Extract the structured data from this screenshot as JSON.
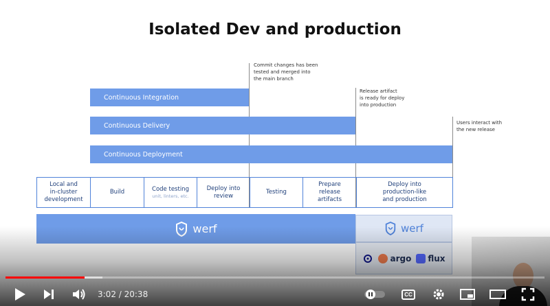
{
  "slide": {
    "title": "Isolated Dev and production",
    "notes": {
      "commit": "Commit changes has been\ntested and merged into\nthe main branch",
      "release": "Release artifact\nis ready for deploy\ninto production",
      "users": "Users interact with\nthe new release"
    },
    "bars": {
      "integration": "Continuous Integration",
      "delivery": "Continuous Delivery",
      "deployment": "Continuous Deployment"
    },
    "stages": [
      {
        "label": "Local and\nin-cluster\ndevelopment",
        "sub": ""
      },
      {
        "label": "Build",
        "sub": ""
      },
      {
        "label": "Code testing",
        "sub": "unit, linters, etc."
      },
      {
        "label": "Deploy into\nreview",
        "sub": ""
      },
      {
        "label": "Testing",
        "sub": ""
      },
      {
        "label": "Prepare\nrelease\nartifacts",
        "sub": ""
      },
      {
        "label": "Deploy into\nproduction-like\nand production",
        "sub": ""
      }
    ],
    "werf_main": "werf",
    "werf_right": "werf",
    "tools": {
      "helm": "HELM",
      "argo": "argo",
      "flux": "flux"
    }
  },
  "player": {
    "time_current": "3:02",
    "time_total": "20:38",
    "time_display": "3:02 / 20:38",
    "progress_fraction": 0.147,
    "buffered_fraction": 0.18,
    "controls": {
      "play": "play-icon",
      "next": "next-icon",
      "volume": "volume-icon",
      "autoplay": "autoplay-toggle-icon",
      "captions": "CC",
      "settings": "gear-icon",
      "miniplayer": "miniplayer-icon",
      "theater": "theater-icon",
      "fullscreen": "fullscreen-icon"
    },
    "colors": {
      "progress": "#ff0000",
      "bar_blue": "#6f9ce8"
    }
  }
}
